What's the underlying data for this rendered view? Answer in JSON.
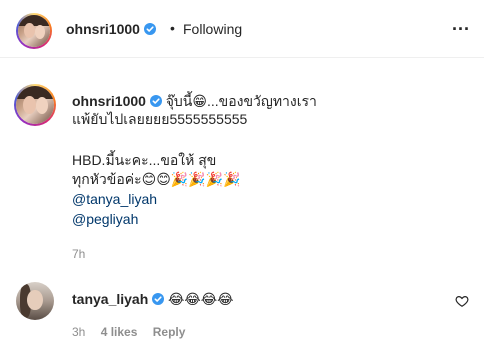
{
  "header": {
    "username": "ohnsri1000",
    "separator": "•",
    "follow_status": "Following",
    "more_icon": "..."
  },
  "caption": {
    "username": "ohnsri1000",
    "line1": "จุ๊บนี้😁...ของขวัญทางเรา",
    "line2": "แพ้ยับไปเลยยยย5555555555",
    "line3": "HBD.มี้นะคะ...ขอให้ สุข",
    "line4": "ทุกหัวข้อค่ะ😊😊🎉🎉🎉🎉",
    "mention1": "@tanya_liyah",
    "mention2": "@pegliyah",
    "time": "7h"
  },
  "comment": {
    "username": "tanya_liyah",
    "text": "😂😂😂😂",
    "time": "3h",
    "likes": "4 likes",
    "reply": "Reply"
  },
  "icons": {
    "verified": "verified-badge-icon",
    "more": "more-options-icon",
    "like": "heart-icon"
  },
  "colors": {
    "verified_blue": "#3897f0",
    "link": "#00376b",
    "meta_gray": "#8e8e8e"
  }
}
